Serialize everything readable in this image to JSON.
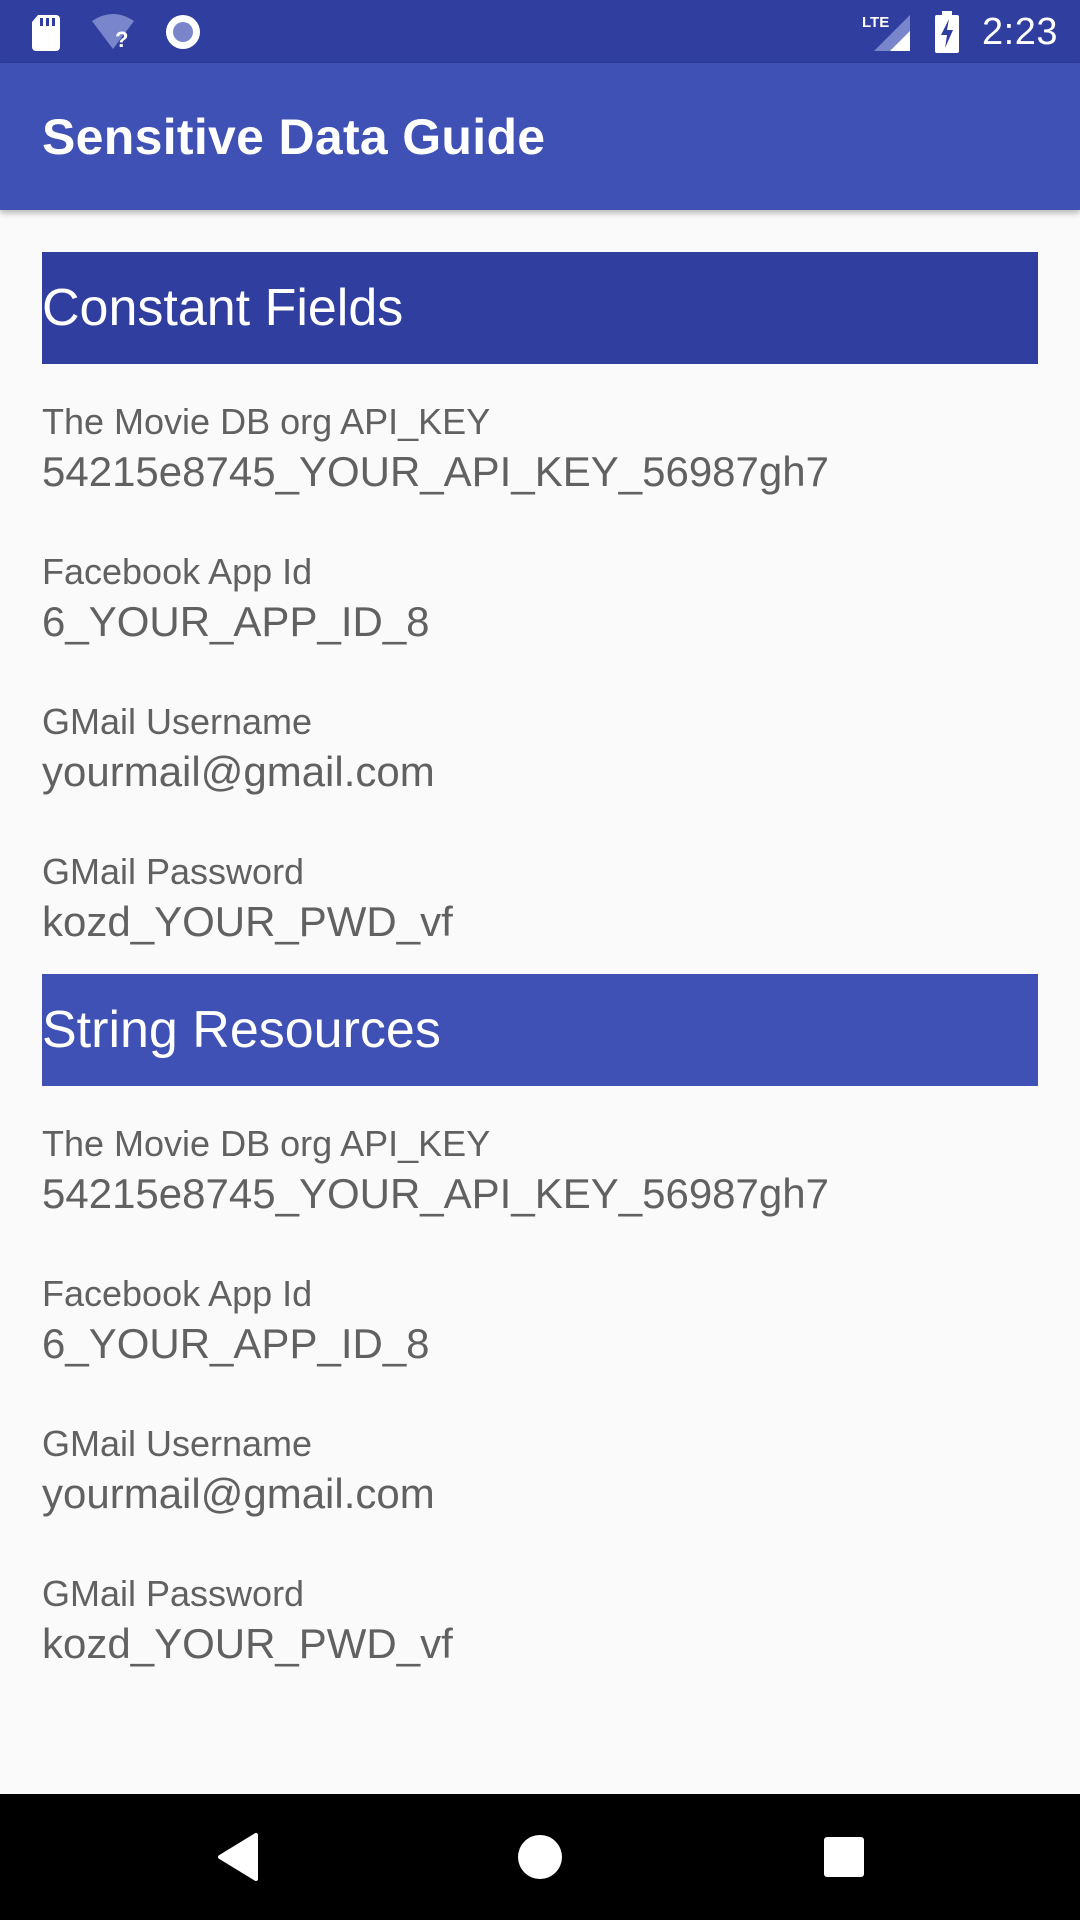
{
  "status_bar": {
    "time": "2:23",
    "network_label": "LTE",
    "icons": [
      "sd-card-icon",
      "wifi-unknown-icon",
      "sync-circle-icon",
      "lte-signal-icon",
      "battery-charging-icon"
    ]
  },
  "app_bar": {
    "title": "Sensitive Data Guide"
  },
  "sections": [
    {
      "header": "Constant Fields",
      "items": [
        {
          "label": "The Movie DB org API_KEY",
          "value": "54215e8745_YOUR_API_KEY_56987gh7"
        },
        {
          "label": "Facebook App Id",
          "value": "6_YOUR_APP_ID_8"
        },
        {
          "label": "GMail Username",
          "value": "yourmail@gmail.com"
        },
        {
          "label": "GMail Password",
          "value": "kozd_YOUR_PWD_vf"
        }
      ]
    },
    {
      "header": "String Resources",
      "items": [
        {
          "label": "The Movie DB org API_KEY",
          "value": "54215e8745_YOUR_API_KEY_56987gh7"
        },
        {
          "label": "Facebook App Id",
          "value": "6_YOUR_APP_ID_8"
        },
        {
          "label": "GMail Username",
          "value": "yourmail@gmail.com"
        },
        {
          "label": "GMail Password",
          "value": "kozd_YOUR_PWD_vf"
        }
      ]
    }
  ],
  "nav_bar": {
    "icons": [
      "back-icon",
      "home-icon",
      "recents-icon"
    ]
  },
  "colors": {
    "status_bar": "#303f9f",
    "app_bar": "#3f51b5",
    "section_constant": "#303f9f",
    "section_resources": "#3f51b5",
    "text_secondary": "#616161",
    "background": "#fafafa"
  }
}
